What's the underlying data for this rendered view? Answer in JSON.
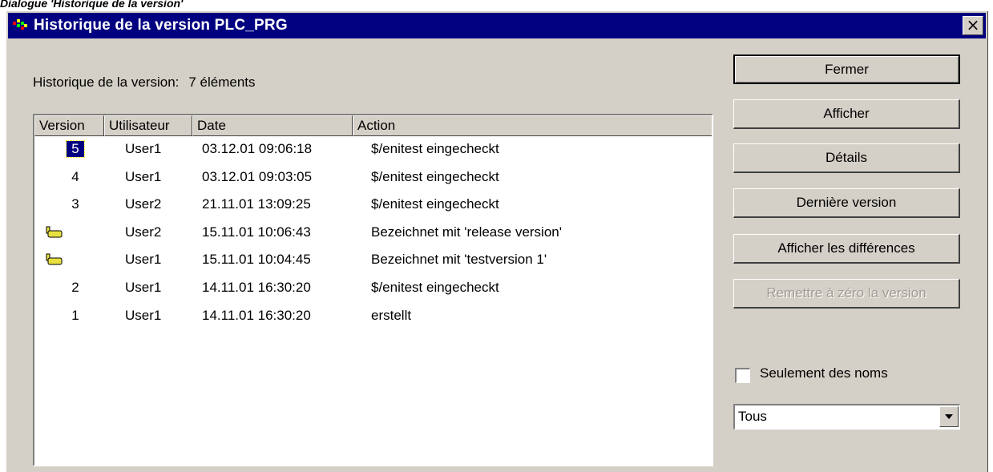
{
  "caption": "Dialogue 'Historique de la version'",
  "window": {
    "title": "Historique de la version PLC_PRG",
    "close_label": "×"
  },
  "summary": {
    "label": "Historique de la version:",
    "count": "7 éléments"
  },
  "table": {
    "columns": [
      "Version",
      "Utilisateur",
      "Date",
      "Action"
    ],
    "rows": [
      {
        "version": "5",
        "user": "User1",
        "date": "03.12.01 09:06:18",
        "action": "$/enitest eingecheckt",
        "icon": "",
        "selected": true
      },
      {
        "version": "4",
        "user": "User1",
        "date": "03.12.01 09:03:05",
        "action": "$/enitest eingecheckt",
        "icon": ""
      },
      {
        "version": "3",
        "user": "User2",
        "date": "21.11.01 13:09:25",
        "action": "$/enitest eingecheckt",
        "icon": ""
      },
      {
        "version": "",
        "user": "User2",
        "date": "15.11.01 10:06:43",
        "action": "Bezeichnet mit 'release version'",
        "icon": "label-tag-icon"
      },
      {
        "version": "",
        "user": "User1",
        "date": "15.11.01 10:04:45",
        "action": "Bezeichnet mit 'testversion 1'",
        "icon": "label-tag-icon"
      },
      {
        "version": "2",
        "user": "User1",
        "date": "14.11.01 16:30:20",
        "action": "$/enitest eingecheckt",
        "icon": ""
      },
      {
        "version": "1",
        "user": "User1",
        "date": "14.11.01 16:30:20",
        "action": "erstellt",
        "icon": ""
      }
    ]
  },
  "buttons": {
    "close": "Fermer",
    "show": "Afficher",
    "details": "Détails",
    "latest": "Dernière version",
    "diff": "Afficher les différences",
    "reset": "Remettre à zéro la version"
  },
  "filter": {
    "names_only_label": "Seulement des noms",
    "names_only_checked": false,
    "scope_value": "Tous"
  },
  "colors": {
    "titlebar": "#000080",
    "dialog_bg": "#d4d0c8",
    "selection": "#000080",
    "tag_icon": "#e8e040"
  }
}
